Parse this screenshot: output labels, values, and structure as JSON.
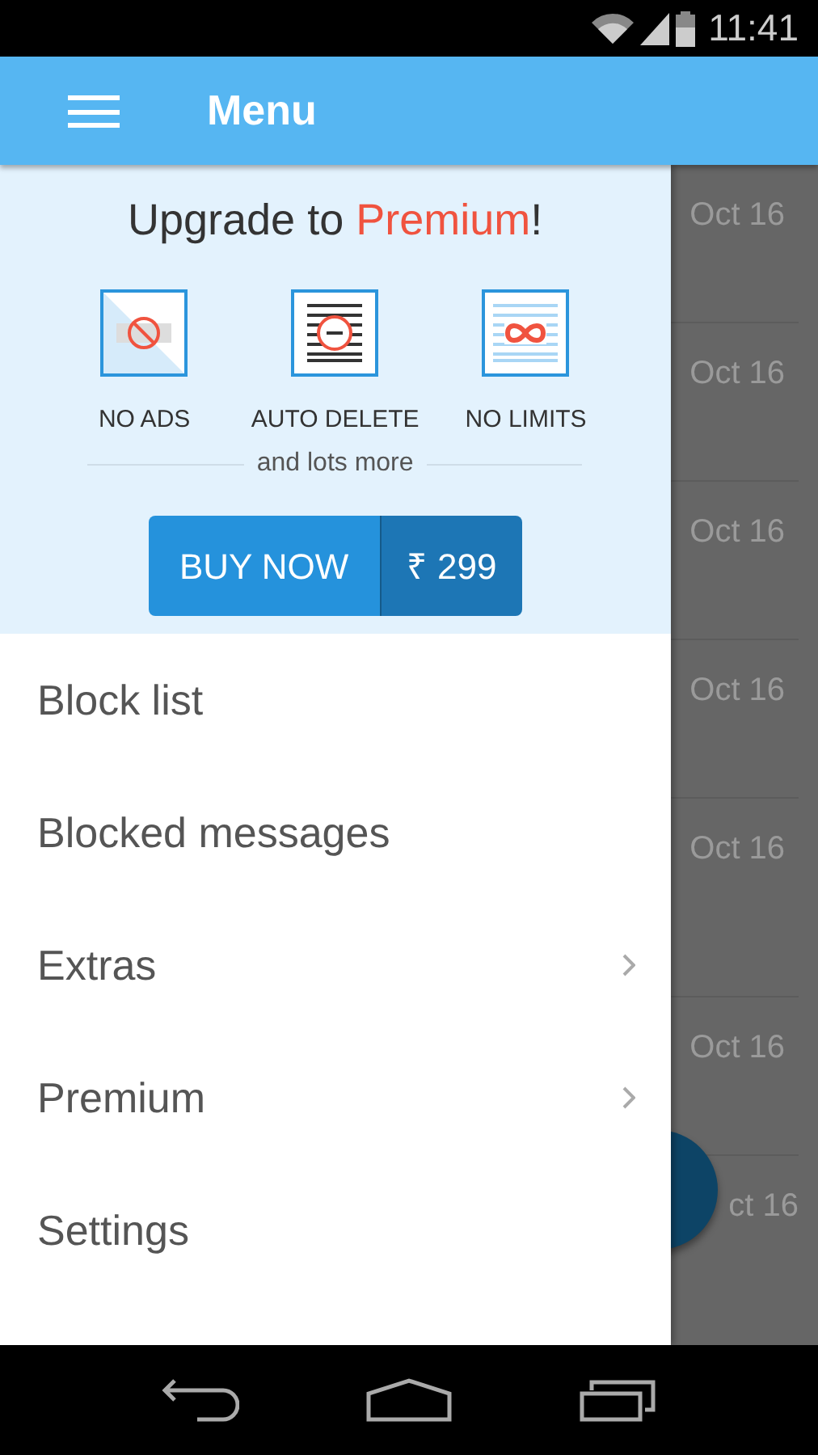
{
  "status_bar": {
    "time": "11:41"
  },
  "app_bar": {
    "title": "Menu"
  },
  "promo": {
    "title": "Upgrade to **Premium**!",
    "features": [
      {
        "kind": "no-ads",
        "label": "NO ADS"
      },
      {
        "kind": "auto-delete",
        "label": "AUTO DELETE"
      },
      {
        "kind": "no-limits",
        "label": "NO LIMITS"
      }
    ],
    "more": "and lots more",
    "buy_label": "BUY NOW",
    "price": "₹ 299"
  },
  "menu_items": [
    {
      "label": "Block list",
      "has_submenu": false
    },
    {
      "label": "Blocked messages",
      "has_submenu": false
    },
    {
      "label": "Extras",
      "has_submenu": true
    },
    {
      "label": "Premium",
      "has_submenu": true
    },
    {
      "label": "Settings",
      "has_submenu": false
    }
  ],
  "background_list": [
    {
      "date": "Oct 16"
    },
    {
      "date": "Oct 16"
    },
    {
      "date": "Oct 16"
    },
    {
      "date": "Oct 16"
    },
    {
      "date": "Oct 16"
    },
    {
      "date": "Oct 16"
    },
    {
      "date": "ct 16"
    }
  ]
}
